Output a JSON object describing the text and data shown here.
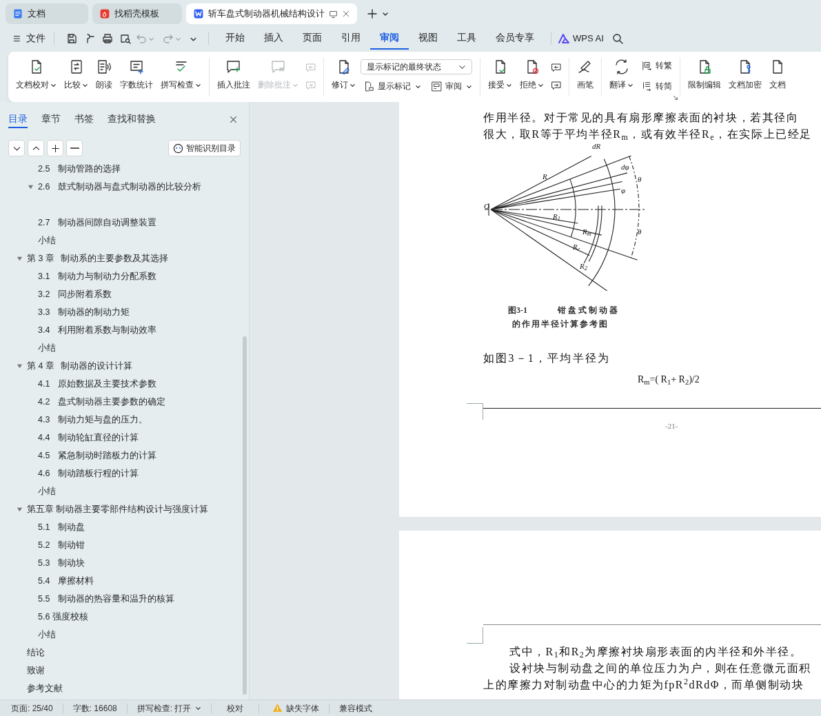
{
  "tabs": [
    {
      "title": "文档",
      "selected": false
    },
    {
      "title": "找稻壳模板",
      "selected": false
    },
    {
      "title": "斩车盘式制动器机械结构设计",
      "selected": true
    }
  ],
  "menu": {
    "file": "文件",
    "tabs": [
      {
        "label": "开始",
        "selected": false
      },
      {
        "label": "插入",
        "selected": false
      },
      {
        "label": "页面",
        "selected": false
      },
      {
        "label": "引用",
        "selected": false
      },
      {
        "label": "审阅",
        "selected": true
      },
      {
        "label": "视图",
        "selected": false
      },
      {
        "label": "工具",
        "selected": false
      },
      {
        "label": "会员专享",
        "selected": false
      }
    ],
    "ai": "WPS AI"
  },
  "ribbon": {
    "groups": [
      {
        "items": [
          {
            "kind": "large",
            "label": "文档校对",
            "menu": true,
            "disabled": false
          },
          {
            "kind": "large",
            "label": "比较",
            "menu": true,
            "disabled": false
          },
          {
            "kind": "large",
            "label": "朗读",
            "menu": false,
            "disabled": false
          },
          {
            "kind": "large",
            "label": "字数统计",
            "menu": false,
            "disabled": false
          },
          {
            "kind": "large",
            "label": "拼写检查",
            "menu": true,
            "disabled": false
          }
        ]
      },
      {
        "items": [
          {
            "kind": "large",
            "label": "插入批注",
            "menu": false,
            "disabled": false
          },
          {
            "kind": "large",
            "label": "删除批注",
            "menu": true,
            "disabled": true
          },
          {
            "kind": "icons",
            "disabled": true
          }
        ]
      },
      {
        "items": [
          {
            "kind": "large",
            "label": "修订",
            "menu": true,
            "disabled": false
          },
          {
            "kind": "stack",
            "rows": [
              [
                {
                  "kind": "select",
                  "value": "显示标记的最终状态"
                }
              ],
              [
                {
                  "kind": "small",
                  "label": "显示标记",
                  "menu": true
                },
                {
                  "kind": "small",
                  "label": "审阅",
                  "menu": true
                }
              ]
            ]
          }
        ]
      },
      {
        "items": [
          {
            "kind": "large",
            "label": "接受",
            "menu": true,
            "disabled": false
          },
          {
            "kind": "large",
            "label": "拒绝",
            "menu": true,
            "disabled": false
          },
          {
            "kind": "icons",
            "disabled": false
          }
        ]
      },
      {
        "items": [
          {
            "kind": "large",
            "label": "画笔",
            "menu": false,
            "disabled": false
          }
        ]
      },
      {
        "items": [
          {
            "kind": "large",
            "label": "翻译",
            "menu": true,
            "disabled": false
          },
          {
            "kind": "stack",
            "rows": [
              [
                {
                  "kind": "small",
                  "label": "转繁",
                  "menu": false
                }
              ],
              [
                {
                  "kind": "small",
                  "label": "转简",
                  "menu": false
                }
              ]
            ]
          }
        ]
      },
      {
        "items": [
          {
            "kind": "large",
            "label": "限制编辑",
            "menu": false,
            "disabled": false
          },
          {
            "kind": "large",
            "label": "文档加密",
            "menu": false,
            "disabled": false
          },
          {
            "kind": "large",
            "label": "文档",
            "menu": false,
            "disabled": false
          }
        ]
      }
    ]
  },
  "pane": {
    "tabs": [
      {
        "label": "目录",
        "selected": true
      },
      {
        "label": "章节",
        "selected": false
      },
      {
        "label": "书签",
        "selected": false
      },
      {
        "label": "查找和替换",
        "selected": false
      }
    ],
    "smart_button": "智能识别目录"
  },
  "toc": {
    "continued": [
      {
        "number": "2.5",
        "title": "制动管路的选择"
      },
      {
        "number": "2.6",
        "title": "鼓式制动器与盘式制动器的比较分析",
        "expanded": true
      },
      {
        "number": "2.7",
        "title": "制动器间隙自动调整装置"
      },
      {
        "title": "小结"
      }
    ],
    "items": [
      {
        "number": "第 3 章",
        "title": "制动系的主要参数及其选择",
        "expanded": true,
        "children": [
          {
            "number": "3.1",
            "title": "制动力与制动力分配系数"
          },
          {
            "number": "3.2",
            "title": "同步附着系数"
          },
          {
            "number": "3.3",
            "title": "制动器的制动力矩"
          },
          {
            "number": "3.4",
            "title": "利用附着系数与制动效率"
          },
          {
            "title": "小结"
          }
        ]
      },
      {
        "number": "第 4 章",
        "title": "制动器的设计计算",
        "expanded": true,
        "children": [
          {
            "number": "4.1",
            "title": "原始数据及主要技术参数"
          },
          {
            "number": "4.2",
            "title": "盘式制动器主要参数的确定"
          },
          {
            "number": "4.3",
            "title": "制动力矩与盘的压力。"
          },
          {
            "number": "4.4",
            "title": "制动轮缸直径的计算"
          },
          {
            "number": "4.5",
            "title": "紧急制动时踏板力的计算"
          },
          {
            "number": "4.6",
            "title": "制动踏板行程的计算"
          },
          {
            "title": "小结"
          }
        ]
      },
      {
        "title": "第五章  制动器主要零部件结构设计与强度计算",
        "expanded": true,
        "children": [
          {
            "number": "5.1",
            "title": "制动盘"
          },
          {
            "number": "5.2",
            "title": "制动钳"
          },
          {
            "number": "5.3",
            "title": "制动块"
          },
          {
            "number": "5.4",
            "title": "摩擦材料"
          },
          {
            "number": "5.5",
            "title": "制动器的热容量和温升的核算"
          },
          {
            "title": "5.6 强度校核"
          },
          {
            "title": "小结"
          }
        ]
      },
      {
        "title": "结论"
      },
      {
        "title": "致谢"
      },
      {
        "title": "参考文献"
      }
    ]
  },
  "page1": {
    "lines": [
      "作用半径。对于常见的具有扇形摩擦表面的衬块，若其径向",
      "很大，取R等于平均半径R$_{m}$，或有效半径R$_{e}$，在实际上已经足"
    ],
    "figure": {
      "labels": [
        "dR",
        "R",
        "dφ",
        "φ",
        "θ",
        "O",
        "R$_{1}$",
        "R$_{m}$",
        "θ",
        "R$_{e}$",
        "R$_{2}$"
      ],
      "caption_number": "图3-1",
      "caption_title": "钳盘式制动器",
      "caption_line2": "的作用半径计算参考图"
    },
    "text_after": "如图3－1，平均半径为",
    "formula": "R$_{m}$=( R$_{1}$+ R$_{2}$)/2",
    "page_number": "-21-"
  },
  "page2": {
    "paragraphs": [
      {
        "lines": [
          "式中，R$_{1}$和R$_{2}$为摩擦衬块扇形表面的内半径和外半径。"
        ]
      },
      {
        "lines": [
          "设衬块与制动盘之间的单位压力为户，则在任意微元面积",
          "上的摩擦力对制动盘中心的力矩为fpR$^{2}$dRdΦ，而单侧制动块"
        ]
      }
    ]
  },
  "status_bar": {
    "page": "页面: 25/40",
    "words": "字数: 16608",
    "spell": "拼写检查: 打开",
    "proofread": "校对",
    "missing_fonts": "缺失字体",
    "compat": "兼容模式"
  }
}
